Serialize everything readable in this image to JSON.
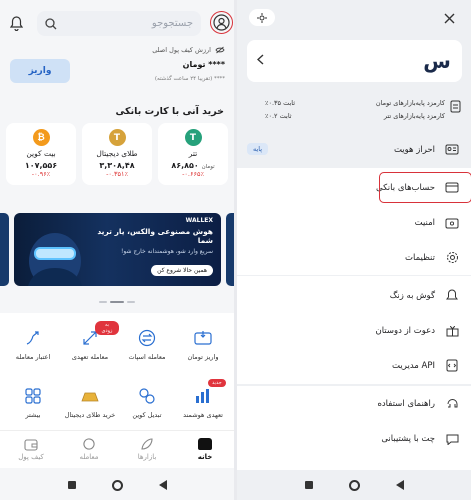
{
  "left": {
    "search": {
      "placeholder": "جستجوجو"
    },
    "balance": {
      "label": "ارزش کیف پول اصلی",
      "stars": "**** تومان",
      "sub": "**** (تقریبا ۲۴ ساعت گذشته)",
      "deposit_label": "واریز"
    },
    "section_title": "خرید آنی با کارت بانکی",
    "cards": [
      {
        "name": "بیت کوین",
        "price": "۱۰۷,۵۵۶",
        "unit": "",
        "change": "-۰.۹۶٪",
        "color": "#f39a1c",
        "symbol": "₿"
      },
      {
        "name": "طلای دیجیتال",
        "price": "۳,۳۰۸,۴۸",
        "unit": "",
        "change": "-۰.۳۵۱٪",
        "color": "#d6a23a",
        "symbol": "T"
      },
      {
        "name": "تتر",
        "price": "۸۶,۸۵۰",
        "unit": "تومان",
        "change": "-۰.۶۶۵٪",
        "color": "#26a17b",
        "symbol": "T"
      }
    ],
    "banner": {
      "logo": "WALLEX",
      "headline_1": "هوش مصنوعی والکس، یار ترید شما",
      "sub": "سریع وارد شو، هوشمندانه خارج شو!",
      "cta": "همین حالا شروع کن"
    },
    "services": [
      {
        "label": "واریز تومان",
        "icon": "deposit-toman-icon"
      },
      {
        "label": "معامله اسپات",
        "icon": "spot-trade-icon"
      },
      {
        "label": "معامله تعهدی",
        "icon": "margin-trade-icon",
        "badge": "به زودی"
      },
      {
        "label": "اعتبار معامله",
        "icon": "trade-credit-icon"
      },
      {
        "label": "تعهدی هوشمند",
        "icon": "smart-margin-icon",
        "badge": "جدید"
      },
      {
        "label": "تبدیل کوین",
        "icon": "coin-convert-icon"
      },
      {
        "label": "خرید طلای دیجیتال",
        "icon": "gold-buy-icon"
      },
      {
        "label": "بیشتر",
        "icon": "more-grid-icon"
      }
    ],
    "nav": [
      {
        "label": "خانه",
        "active": true
      },
      {
        "label": "بازارها",
        "active": false
      },
      {
        "label": "معامله",
        "active": false
      },
      {
        "label": "کیف پول",
        "active": false
      }
    ]
  },
  "right": {
    "account_rows": [
      {
        "label": "کارمزد پایه‌بازارهای تومان",
        "value": "ثابت ۰.۳۵٪"
      },
      {
        "label": "کارمزد پایه‌بازارهای تتر",
        "value": "ثابت ۰.۲٪"
      }
    ],
    "kyc": {
      "label": "احراز هویت",
      "level": "پایه"
    },
    "menu_group_1": [
      {
        "label": "حساب‌های بانکی",
        "icon": "bank-card-icon"
      },
      {
        "label": "امنیت",
        "icon": "security-icon"
      },
      {
        "label": "تنظیمات",
        "icon": "settings-gear-icon"
      }
    ],
    "menu_group_2": [
      {
        "label": "گوش به زنگ",
        "icon": "alert-icon"
      },
      {
        "label": "دعوت از دوستان",
        "icon": "invite-icon"
      },
      {
        "label": "مدیریت API",
        "icon": "api-icon"
      }
    ],
    "menu_group_3": [
      {
        "label": "راهنمای استفاده",
        "icon": "help-icon"
      },
      {
        "label": "چت با پشتیبانی",
        "icon": "chat-support-icon"
      }
    ]
  }
}
